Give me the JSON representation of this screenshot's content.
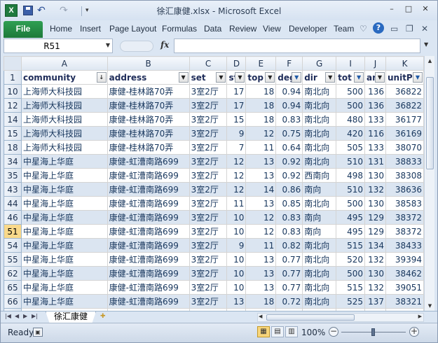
{
  "window": {
    "title": "徐汇康健.xlsx - Microsoft Excel",
    "min": "–",
    "max": "□",
    "close": "✕"
  },
  "quick_access": {
    "logo": "X",
    "undo": "↶",
    "redo": "↷",
    "more": "▾"
  },
  "ribbon": {
    "file_label": "File",
    "tabs": [
      "Home",
      "Insert",
      "Page Layout",
      "Formulas",
      "Data",
      "Review",
      "View",
      "Developer",
      "Team"
    ],
    "help": "?"
  },
  "formula_bar": {
    "name_box": "R51",
    "fx": "fx",
    "formula": ""
  },
  "columns": {
    "letters": [
      "A",
      "B",
      "C",
      "D",
      "E",
      "F",
      "G",
      "I",
      "J",
      "K"
    ],
    "headers": [
      "community",
      "address",
      "set",
      "st",
      "top",
      "deg",
      "dir",
      "tot",
      "are",
      "unitP"
    ],
    "filter_states": [
      "sort",
      "none",
      "none",
      "none",
      "none",
      "active",
      "none",
      "active",
      "none",
      "active"
    ]
  },
  "header_row_number": "1",
  "rows": [
    {
      "num": "10",
      "cells": [
        "上海师大科技园",
        "康健-桂林路70弄",
        "3室2厅",
        "17",
        "18",
        "0.94",
        "南北向",
        "500",
        "136",
        "36822"
      ]
    },
    {
      "num": "12",
      "cells": [
        "上海师大科技园",
        "康健-桂林路70弄",
        "3室2厅",
        "17",
        "18",
        "0.94",
        "南北向",
        "500",
        "136",
        "36822"
      ]
    },
    {
      "num": "14",
      "cells": [
        "上海师大科技园",
        "康健-桂林路70弄",
        "3室2厅",
        "15",
        "18",
        "0.83",
        "南北向",
        "480",
        "133",
        "36177"
      ]
    },
    {
      "num": "15",
      "cells": [
        "上海师大科技园",
        "康健-桂林路70弄",
        "3室2厅",
        "9",
        "12",
        "0.75",
        "南北向",
        "420",
        "116",
        "36169"
      ]
    },
    {
      "num": "18",
      "cells": [
        "上海师大科技园",
        "康健-桂林路70弄",
        "3室2厅",
        "7",
        "11",
        "0.64",
        "南北向",
        "505",
        "133",
        "38070"
      ]
    },
    {
      "num": "34",
      "cells": [
        "中星海上华庭",
        "康健-虹漕南路699",
        "3室2厅",
        "12",
        "13",
        "0.92",
        "南北向",
        "510",
        "131",
        "38833"
      ]
    },
    {
      "num": "35",
      "cells": [
        "中星海上华庭",
        "康健-虹漕南路699",
        "3室2厅",
        "12",
        "13",
        "0.92",
        "西南向",
        "498",
        "130",
        "38308"
      ]
    },
    {
      "num": "43",
      "cells": [
        "中星海上华庭",
        "康健-虹漕南路699",
        "3室2厅",
        "12",
        "14",
        "0.86",
        "南向",
        "510",
        "132",
        "38636"
      ]
    },
    {
      "num": "44",
      "cells": [
        "中星海上华庭",
        "康健-虹漕南路699",
        "3室2厅",
        "11",
        "13",
        "0.85",
        "南北向",
        "500",
        "130",
        "38583"
      ]
    },
    {
      "num": "46",
      "cells": [
        "中星海上华庭",
        "康健-虹漕南路699",
        "3室2厅",
        "10",
        "12",
        "0.83",
        "南向",
        "495",
        "129",
        "38372"
      ]
    },
    {
      "num": "51",
      "cells": [
        "中星海上华庭",
        "康健-虹漕南路699",
        "3室2厅",
        "10",
        "12",
        "0.83",
        "南向",
        "495",
        "129",
        "38372"
      ],
      "active": true
    },
    {
      "num": "54",
      "cells": [
        "中星海上华庭",
        "康健-虹漕南路699",
        "3室2厅",
        "9",
        "11",
        "0.82",
        "南北向",
        "515",
        "134",
        "38433"
      ]
    },
    {
      "num": "55",
      "cells": [
        "中星海上华庭",
        "康健-虹漕南路699",
        "3室2厅",
        "10",
        "13",
        "0.77",
        "南北向",
        "520",
        "132",
        "39394"
      ]
    },
    {
      "num": "62",
      "cells": [
        "中星海上华庭",
        "康健-虹漕南路699",
        "3室2厅",
        "10",
        "13",
        "0.77",
        "南北向",
        "500",
        "130",
        "38462"
      ]
    },
    {
      "num": "65",
      "cells": [
        "中星海上华庭",
        "康健-虹漕南路699",
        "3室2厅",
        "10",
        "13",
        "0.77",
        "南北向",
        "515",
        "132",
        "39051"
      ]
    },
    {
      "num": "66",
      "cells": [
        "中星海上华庭",
        "康健-虹漕南路699",
        "3室2厅",
        "13",
        "18",
        "0.72",
        "南北向",
        "525",
        "137",
        "38321"
      ]
    },
    {
      "num": "",
      "cells": [
        "中星海上华庭",
        "康健-虹漕南路",
        "3室2厅",
        "",
        "",
        "",
        "南北向",
        "",
        "",
        ""
      ]
    }
  ],
  "sheet_tabs": {
    "active": "徐汇康健"
  },
  "status": {
    "ready": "Ready",
    "zoom": "100%"
  },
  "colors": {
    "band": "#dbe5f1",
    "active_row": "#f9d98a",
    "file_tab": "#1d7a3a"
  }
}
